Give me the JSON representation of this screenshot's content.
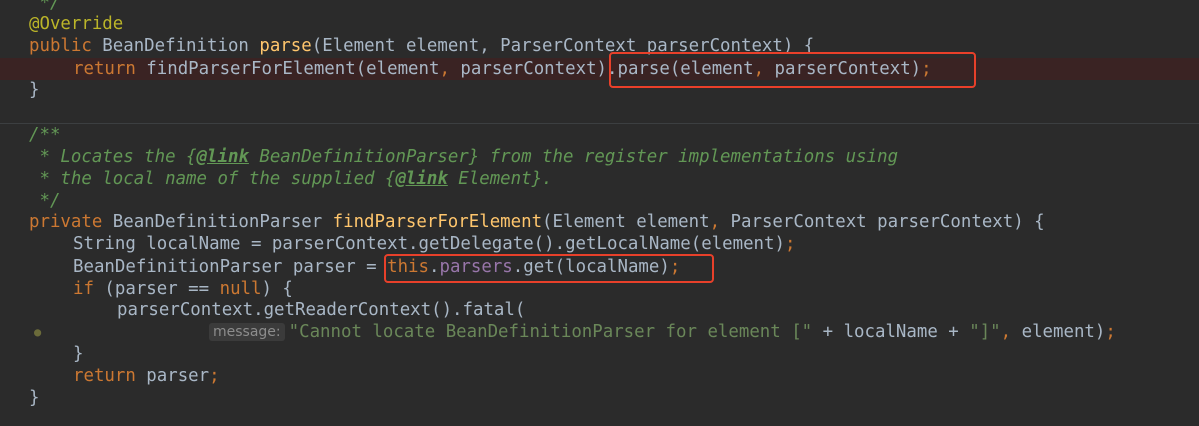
{
  "code": {
    "l0": {
      "text": " */"
    },
    "l1": {
      "annotation": "@Override"
    },
    "l2": {
      "kw": "public",
      "type": " BeanDefinition ",
      "name": "parse",
      "rest": "(Element element, ParserContext parserContext) {"
    },
    "l3": {
      "kw": "return",
      "a": " findParserForElement(element",
      "comma1": ",",
      "b": " parserContext).parse(element",
      "comma2": ",",
      "c": " parserContext)",
      "semi": ";"
    },
    "l4": {
      "text": "}"
    },
    "l5": {
      "text": "/**"
    },
    "l6": {
      "a": " * Locates the {",
      "tag": "@link",
      "b": " BeanDefinitionParser} from the register implementations using"
    },
    "l7": {
      "a": " * the local name of the supplied {",
      "tag": "@link",
      "b": " Element}."
    },
    "l8": {
      "text": " */"
    },
    "l9": {
      "kw": "private",
      "type": " BeanDefinitionParser ",
      "name": "findParserForElement",
      "a": "(Element element",
      "comma": ",",
      "b": " ParserContext parserContext) {"
    },
    "l10": {
      "text": "String localName = parserContext.getDelegate().getLocalName(element)",
      "semi": ";"
    },
    "l11": {
      "a": "BeanDefinitionParser parser = ",
      "kw": "this",
      "dot": ".",
      "field": "parsers",
      "b": ".get(localName)",
      "semi": ";"
    },
    "l12": {
      "kw": "if",
      "a": " (parser == ",
      "kw2": "null",
      "b": ") {"
    },
    "l13": {
      "text": "parserContext.getReaderContext().fatal("
    },
    "l14": {
      "hint": "message:",
      "str1": "\"Cannot locate BeanDefinitionParser for element [\"",
      "mid": " + localName + ",
      "str2": "\"]\"",
      "comma": ",",
      "b": " element)",
      "semi": ";"
    },
    "l15": {
      "text": "}"
    },
    "l16": {
      "kw": "return",
      "a": " parser",
      "semi": ";"
    },
    "l17": {
      "text": "}"
    }
  },
  "colors": {
    "background": "#2b2b2b",
    "keyword": "#cc7832",
    "method_declaration": "#ffc66d",
    "string": "#6a8759",
    "comment": "#629755",
    "annotation": "#bbb529",
    "field": "#9876aa",
    "highlight_box": "#e8402a"
  }
}
